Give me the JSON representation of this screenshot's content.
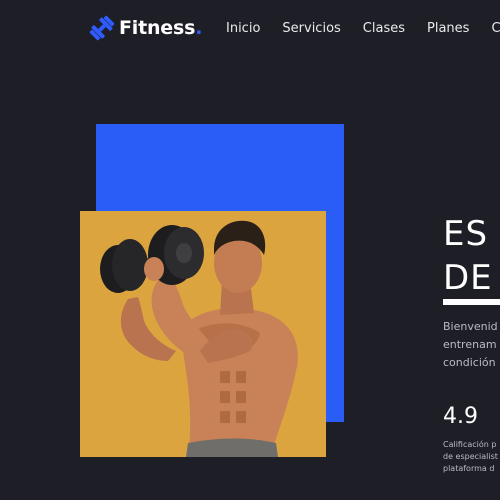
{
  "nav": {
    "brand": "Fitness",
    "brand_dot": ".",
    "logo_icon": "dumbbell-icon",
    "items": [
      {
        "label": "Inicio"
      },
      {
        "label": "Servicios"
      },
      {
        "label": "Clases"
      },
      {
        "label": "Planes"
      },
      {
        "label": "Co"
      }
    ]
  },
  "hero": {
    "title_line1": "ES",
    "title_line2": "DE",
    "description_lines": [
      "Bienvenid",
      "entrenam",
      "condición"
    ],
    "rating": "4.9",
    "rating_caption_lines": [
      "Calificación p",
      "de especialist",
      "plataforma d"
    ]
  },
  "colors": {
    "background": "#1e1f26",
    "accent_blue": "#2a5cf6",
    "photo_background": "#dca43f"
  }
}
